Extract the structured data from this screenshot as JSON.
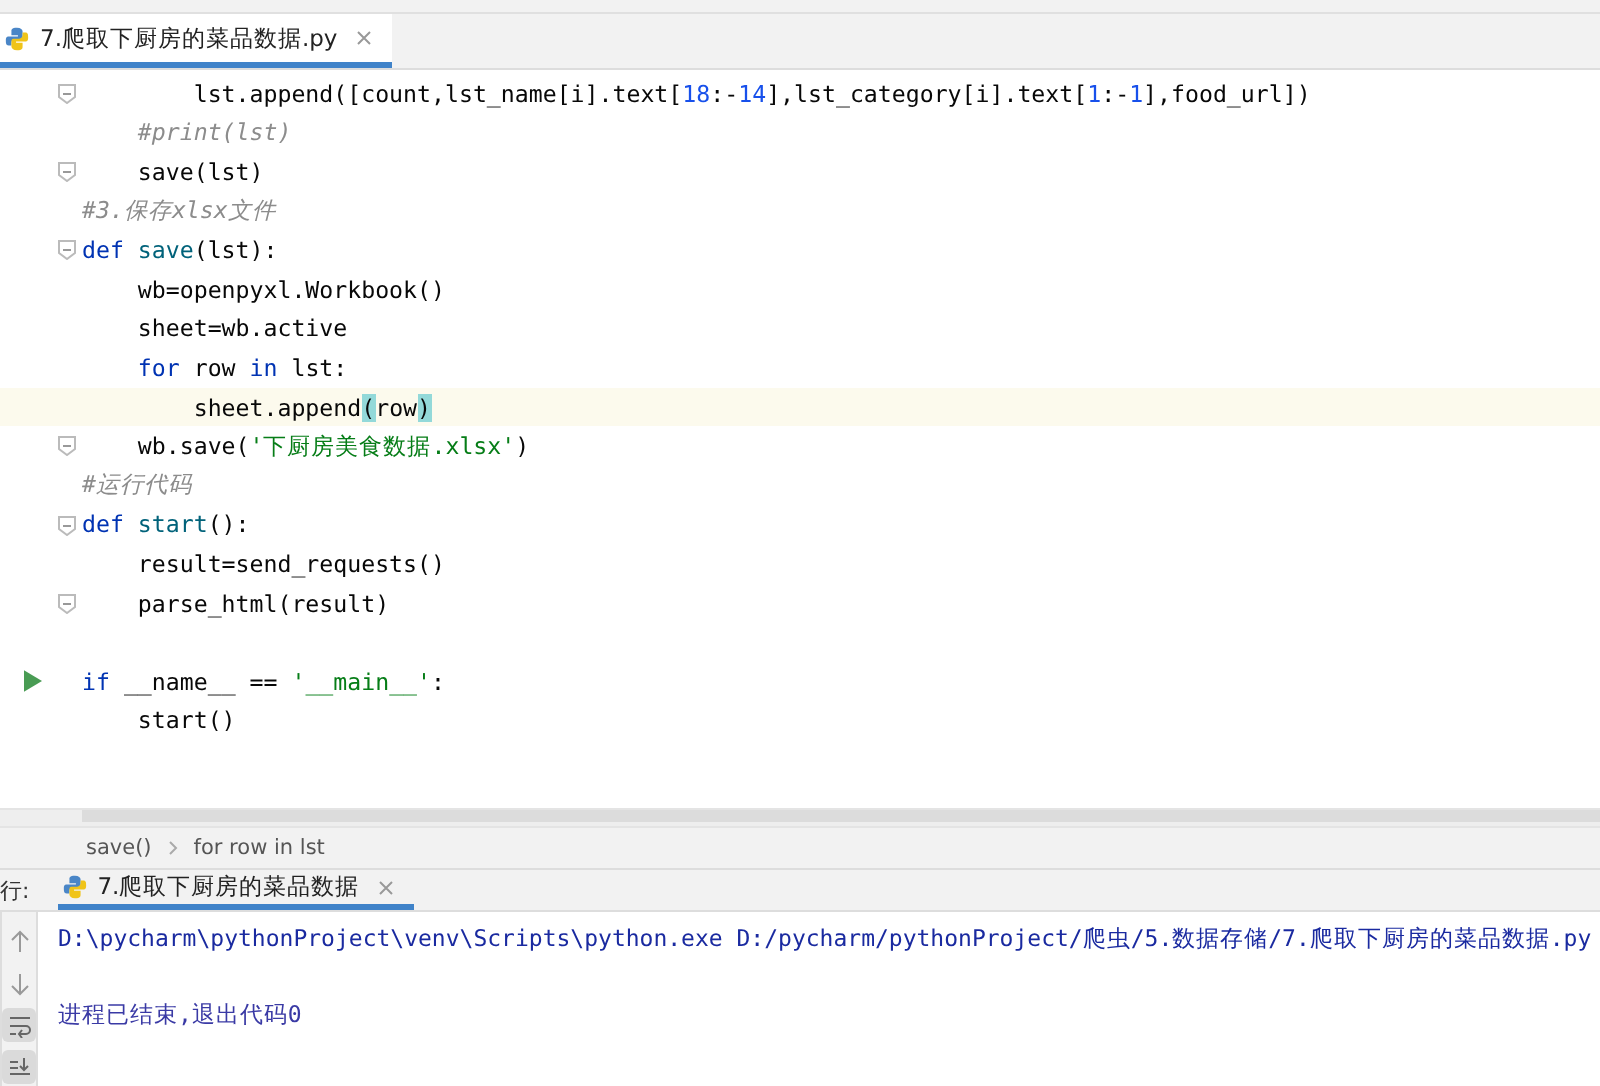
{
  "editor_tab": {
    "title": "7.爬取下厨房的菜品数据.py",
    "selected": true
  },
  "code_lines": [
    {
      "fold": true,
      "current": false,
      "run": false,
      "segments": [
        {
          "t": "        lst.append([count,lst_name[i].text[",
          "kind": "plain"
        },
        {
          "t": "18",
          "kind": "num"
        },
        {
          "t": ":-",
          "kind": "plain"
        },
        {
          "t": "14",
          "kind": "num"
        },
        {
          "t": "],lst_category[i].text[",
          "kind": "plain"
        },
        {
          "t": "1",
          "kind": "num"
        },
        {
          "t": ":-",
          "kind": "plain"
        },
        {
          "t": "1",
          "kind": "num"
        },
        {
          "t": "],food_url])",
          "kind": "plain"
        }
      ]
    },
    {
      "fold": false,
      "current": false,
      "run": false,
      "segments": [
        {
          "t": "    #print(lst)",
          "kind": "comment"
        }
      ]
    },
    {
      "fold": true,
      "current": false,
      "run": false,
      "segments": [
        {
          "t": "    save(lst)",
          "kind": "plain"
        }
      ]
    },
    {
      "fold": false,
      "current": false,
      "run": false,
      "segments": [
        {
          "t": "#3.保存xlsx文件",
          "kind": "comment"
        }
      ]
    },
    {
      "fold": true,
      "current": false,
      "run": false,
      "segments": [
        {
          "t": "def ",
          "kind": "kw"
        },
        {
          "t": "save",
          "kind": "fn"
        },
        {
          "t": "(lst):",
          "kind": "plain"
        }
      ]
    },
    {
      "fold": false,
      "current": false,
      "run": false,
      "segments": [
        {
          "t": "    wb=openpyxl.Workbook()",
          "kind": "plain"
        }
      ]
    },
    {
      "fold": false,
      "current": false,
      "run": false,
      "segments": [
        {
          "t": "    sheet=wb.active",
          "kind": "plain"
        }
      ]
    },
    {
      "fold": false,
      "current": false,
      "run": false,
      "segments": [
        {
          "t": "    for ",
          "kind": "kw"
        },
        {
          "t": "row ",
          "kind": "plain"
        },
        {
          "t": "in ",
          "kind": "kw"
        },
        {
          "t": "lst:",
          "kind": "plain"
        }
      ]
    },
    {
      "fold": false,
      "current": true,
      "run": false,
      "segments": [
        {
          "t": "        sheet.append",
          "kind": "plain"
        },
        {
          "t": "(",
          "kind": "match"
        },
        {
          "t": "row",
          "kind": "plain"
        },
        {
          "t": ")",
          "kind": "match"
        }
      ]
    },
    {
      "fold": true,
      "current": false,
      "run": false,
      "segments": [
        {
          "t": "    wb.save(",
          "kind": "plain"
        },
        {
          "t": "'下厨房美食数据.xlsx'",
          "kind": "str"
        },
        {
          "t": ")",
          "kind": "plain"
        }
      ]
    },
    {
      "fold": false,
      "current": false,
      "run": false,
      "segments": [
        {
          "t": "#运行代码",
          "kind": "comment"
        }
      ]
    },
    {
      "fold": true,
      "current": false,
      "run": false,
      "segments": [
        {
          "t": "def ",
          "kind": "kw"
        },
        {
          "t": "start",
          "kind": "fn"
        },
        {
          "t": "():",
          "kind": "plain"
        }
      ]
    },
    {
      "fold": false,
      "current": false,
      "run": false,
      "segments": [
        {
          "t": "    result=send_requests()",
          "kind": "plain"
        }
      ]
    },
    {
      "fold": true,
      "current": false,
      "run": false,
      "segments": [
        {
          "t": "    parse_html(result)",
          "kind": "plain"
        }
      ]
    },
    {
      "fold": false,
      "current": false,
      "run": false
    },
    {
      "fold": false,
      "current": false,
      "run": true,
      "segments": [
        {
          "t": "if ",
          "kind": "kw"
        },
        {
          "t": "__name__ == ",
          "kind": "plain"
        },
        {
          "t": "'__main__'",
          "kind": "str"
        },
        {
          "t": ":",
          "kind": "plain"
        }
      ]
    },
    {
      "fold": false,
      "current": false,
      "run": false,
      "segments": [
        {
          "t": "    start()",
          "kind": "plain"
        }
      ]
    }
  ],
  "breadcrumbs": [
    "save()",
    "for row in lst"
  ],
  "run_panel": {
    "label": "行:",
    "tab": {
      "title": "7.爬取下厨房的菜品数据",
      "selected": true
    },
    "toolbar": [
      {
        "kind": "up",
        "on": false
      },
      {
        "kind": "down",
        "on": false
      },
      {
        "kind": "wrap",
        "on": true
      },
      {
        "kind": "scroll-end",
        "on": true
      }
    ],
    "output": [
      "D:\\pycharm\\pythonProject\\venv\\Scripts\\python.exe D:/pycharm/pythonProject/爬虫/5.数据存储/7.爬取下厨房的菜品数据.py",
      "进程已结束,退出代码0"
    ]
  }
}
